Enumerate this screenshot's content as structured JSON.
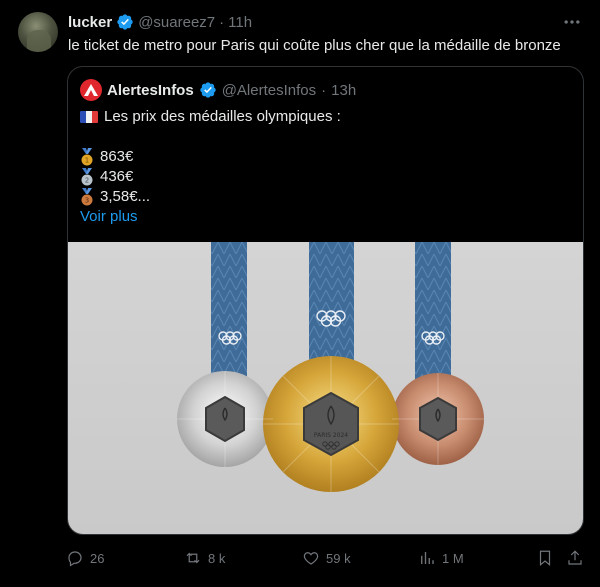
{
  "tweet": {
    "display_name": "lucker",
    "handle": "@suareez7",
    "separator": "·",
    "time": "11h",
    "text": "le ticket de metro pour Paris qui coûte plus cher que la médaille de bronze"
  },
  "quote": {
    "display_name": "AlertesInfos",
    "handle": "@AlertesInfos",
    "separator": "·",
    "time": "13h",
    "headline": "Les prix des médailles olympiques :",
    "prices": [
      {
        "medal": "gold",
        "value": "863€"
      },
      {
        "medal": "silver",
        "value": "436€"
      },
      {
        "medal": "bronze",
        "value": "3,58€..."
      }
    ],
    "more_label": "Voir plus",
    "image_caption": "PARIS 2024"
  },
  "actions": {
    "replies": "26",
    "reposts": "8 k",
    "likes": "59 k",
    "views": "1 M"
  },
  "colors": {
    "accent": "#1d9bf0",
    "muted": "#71767b",
    "background": "#000000",
    "border": "#2f3336"
  }
}
